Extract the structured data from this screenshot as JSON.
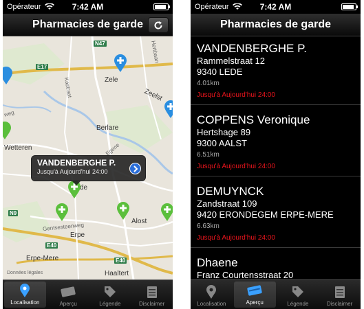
{
  "status": {
    "carrier": "Opérateur",
    "time": "7:42 AM"
  },
  "left": {
    "title": "Pharmacies de garde",
    "map": {
      "places": [
        "Zele",
        "Berlare",
        "Wetteren",
        "Alost",
        "Erpe",
        "Erpe-Mere",
        "Haaltert",
        "Zeelst",
        "de"
      ],
      "roads": [
        "N47",
        "E17",
        "N9",
        "E40",
        "E40"
      ],
      "streets": [
        "Gentsesteenweg",
        "Kastraat",
        "Egene",
        "Hertbaan",
        "weg"
      ],
      "legal": "Données légales",
      "callout": {
        "name": "VANDENBERGHE P.",
        "until": "Jusqu'à Aujourd'hui 24:00"
      }
    }
  },
  "right": {
    "title": "Pharmacies de garde",
    "pharmacies": [
      {
        "name": "VANDENBERGHE P.",
        "street": "Rammelstraat 12",
        "city": "9340 LEDE",
        "distance": "4.01km",
        "until": "Jusqu'à Aujourd'hui 24:00"
      },
      {
        "name": "COPPENS Veronique",
        "street": "Hertshage 89",
        "city": "9300 AALST",
        "distance": "6.51km",
        "until": "Jusqu'à Aujourd'hui 24:00"
      },
      {
        "name": "DEMUYNCK",
        "street": "Zandstraat 109",
        "city": "9420 ERONDEGEM ERPE-MERE",
        "distance": "6.63km",
        "until": "Jusqu'à Aujourd'hui 24:00"
      },
      {
        "name": "Dhaene",
        "street": "Franz Courtensstraat 20",
        "city": "",
        "distance": "",
        "until": ""
      }
    ]
  },
  "tabs": [
    {
      "label": "Localisation",
      "icon": "location-pin-icon"
    },
    {
      "label": "Aperçu",
      "icon": "card-icon"
    },
    {
      "label": "Légende",
      "icon": "tag-icon"
    },
    {
      "label": "Disclaimer",
      "icon": "notepad-icon"
    }
  ],
  "colors": {
    "pin_green": "#5bbf3c",
    "pin_blue": "#2a8ee0",
    "accent_red": "#e8141c",
    "map_bg": "#e9e5dc"
  }
}
